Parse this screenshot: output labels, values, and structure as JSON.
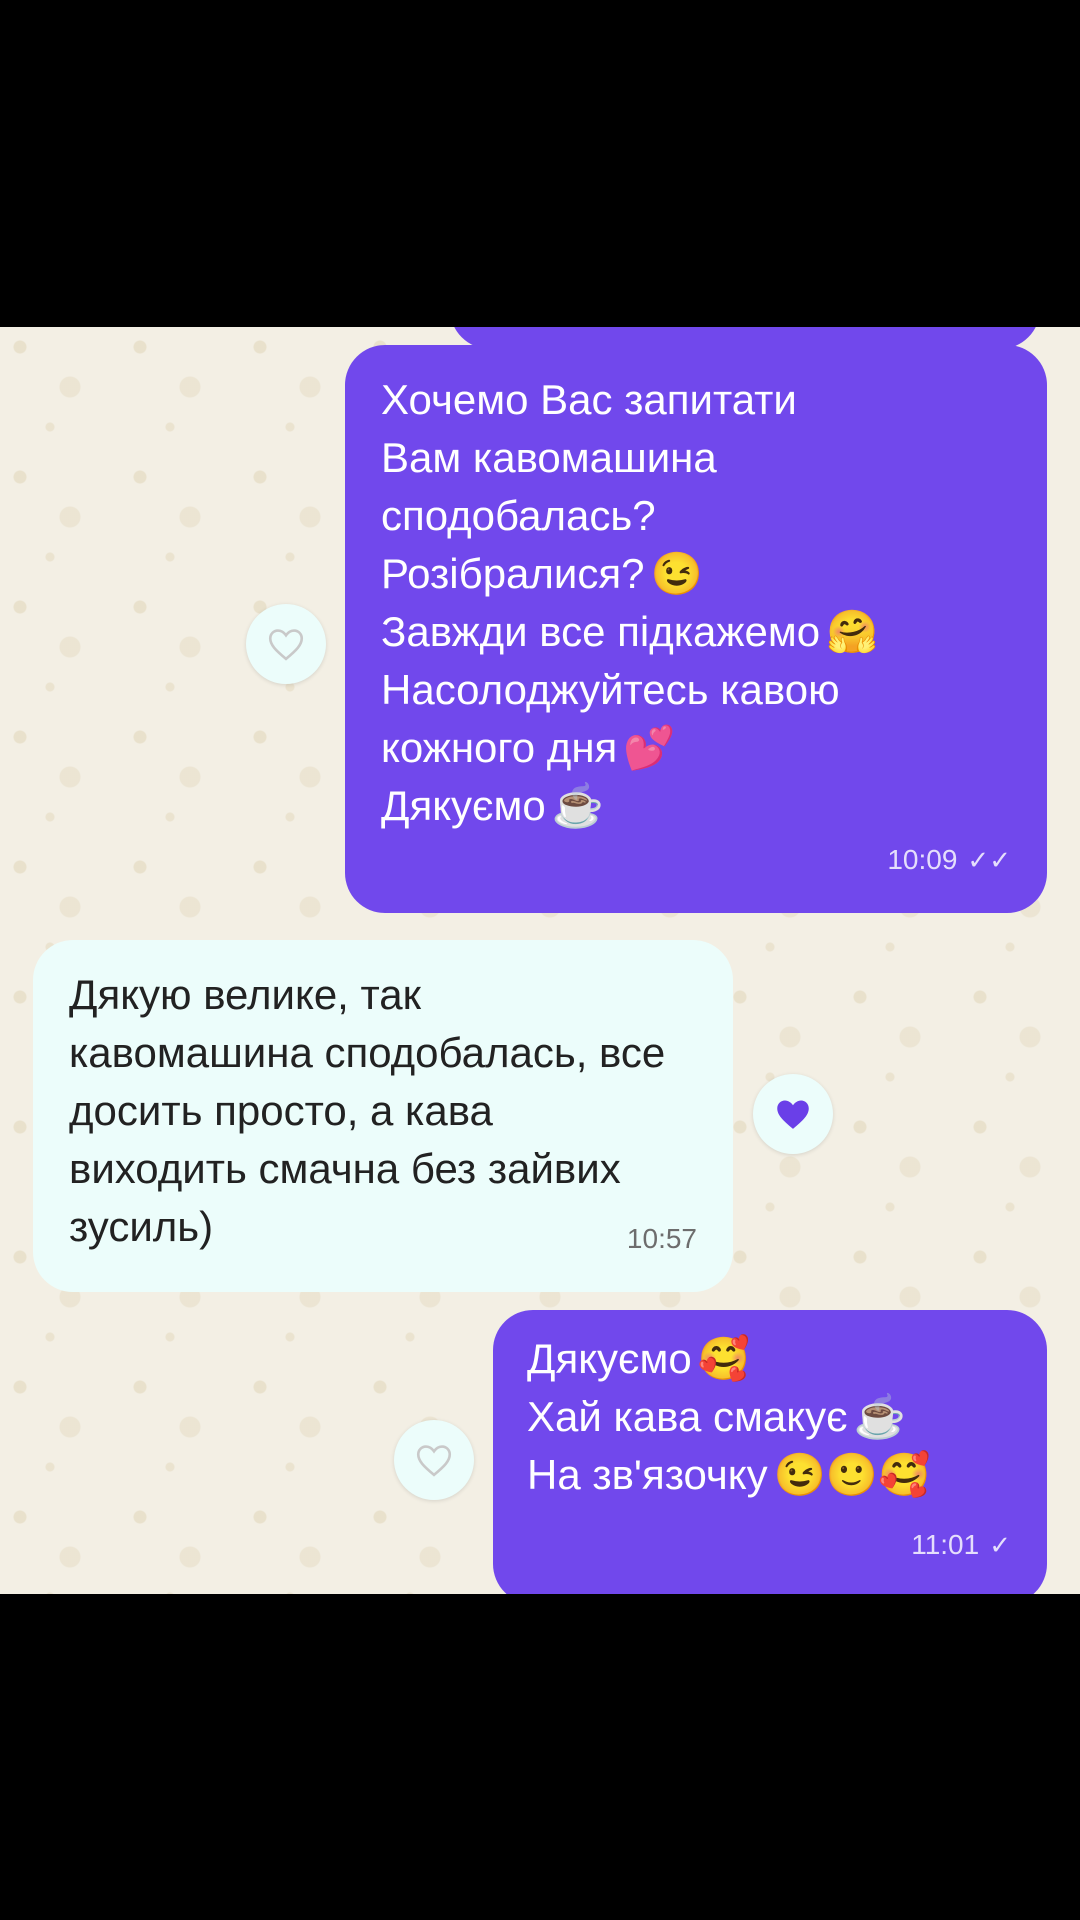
{
  "messages": [
    {
      "direction": "outgoing",
      "lines": [
        {
          "text": "Хочемо Вас запитати",
          "emoji": ""
        },
        {
          "text": "Вам кавомашина",
          "emoji": ""
        },
        {
          "text": "сподобалась?",
          "emoji": ""
        },
        {
          "text": "Розібралися?",
          "emoji": "😉"
        },
        {
          "text": "Завжди все підкажемо",
          "emoji": "🤗"
        },
        {
          "text": "Насолоджуйтесь кавою",
          "emoji": ""
        },
        {
          "text": "кожного дня",
          "emoji": "💕"
        },
        {
          "text": "Дякуємо",
          "emoji": "☕"
        }
      ],
      "time": "10:09",
      "status": "read",
      "status_glyph": "✓✓",
      "reaction": "heart-outline"
    },
    {
      "direction": "incoming",
      "lines": [
        {
          "text": "Дякую велике, так",
          "emoji": ""
        },
        {
          "text": "кавомашина сподобалась, все",
          "emoji": ""
        },
        {
          "text": "досить просто, а кава",
          "emoji": ""
        },
        {
          "text": "виходить смачна без зайвих",
          "emoji": ""
        },
        {
          "text": "зусиль)",
          "emoji": ""
        }
      ],
      "time": "10:57",
      "reaction": "heart-filled"
    },
    {
      "direction": "outgoing",
      "lines": [
        {
          "text": "Дякуємо",
          "emoji": "🥰"
        },
        {
          "text": "Хай кава смакує",
          "emoji": "☕"
        },
        {
          "text": "На зв'язочку",
          "emoji": "😉🙂🥰"
        }
      ],
      "time": "11:01",
      "status": "sent",
      "status_glyph": "✓",
      "reaction": "heart-outline"
    }
  ],
  "colors": {
    "outgoing_bubble": "#7148ec",
    "incoming_bubble": "#ecfdfb",
    "heart_filled": "#6a3fe8",
    "heart_outline": "#c9c9c9"
  }
}
